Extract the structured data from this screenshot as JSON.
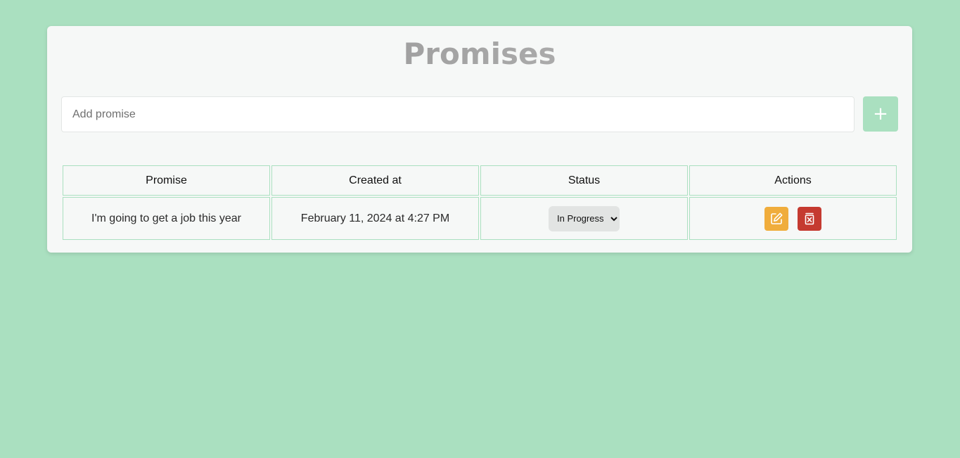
{
  "page": {
    "title": "Promises"
  },
  "add_form": {
    "placeholder": "Add promise",
    "value": "",
    "button_label": "+"
  },
  "table": {
    "headers": {
      "promise": "Promise",
      "created_at": "Created at",
      "status": "Status",
      "actions": "Actions"
    },
    "rows": [
      {
        "promise": "I'm going to get a job this year",
        "created_at": "February 11, 2024 at 4:27 PM",
        "status": "In Progress",
        "actions": [
          "edit-icon",
          "delete-icon"
        ]
      }
    ]
  },
  "colors": {
    "background": "#aae0c0",
    "card": "#f6f8f7",
    "accent": "#aae0c0",
    "edit": "#f0ad3c",
    "delete": "#c53a30"
  }
}
